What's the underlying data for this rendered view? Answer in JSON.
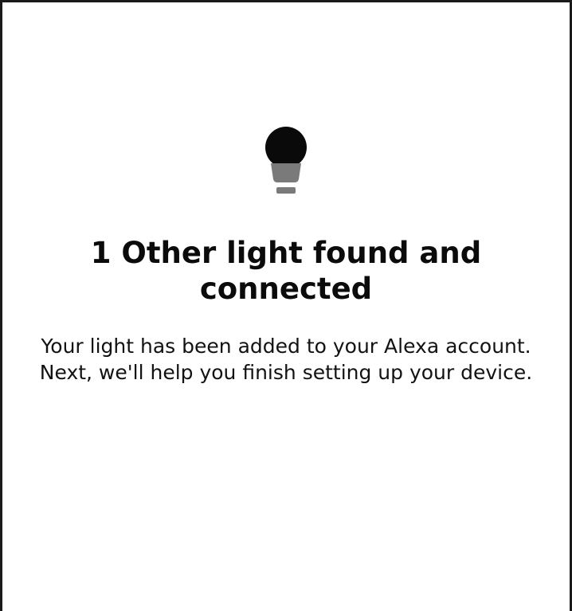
{
  "screen": {
    "icon": "lightbulb-icon",
    "title": "1 Other light found and connected",
    "message": "Your light has been added to your Alexa account. Next, we'll help you finish setting up your device."
  },
  "colors": {
    "bulb_globe": "#0a0a0a",
    "bulb_base": "#7a7a7a",
    "text": "#0b0b0b",
    "frame_border": "#1a1a1a"
  }
}
